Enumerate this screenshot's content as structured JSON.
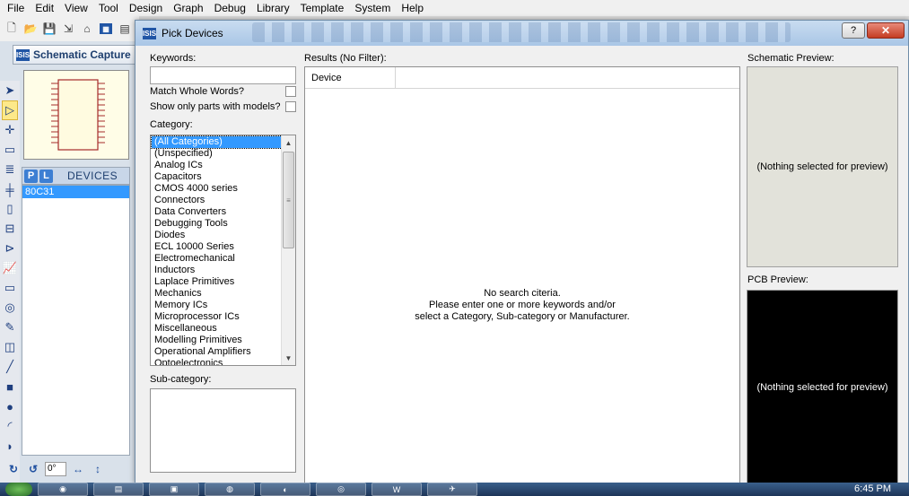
{
  "app": {
    "menu": [
      "File",
      "Edit",
      "View",
      "Tool",
      "Design",
      "Graph",
      "Debug",
      "Library",
      "Template",
      "System",
      "Help"
    ],
    "tab_label": "Schematic Capture",
    "logo_text": "ISIS",
    "devices_title": "DEVICES",
    "pick_btn": "P",
    "lib_btn": "L",
    "devices": [
      "80C31"
    ],
    "rotation_value": "0°"
  },
  "dialog": {
    "title": "Pick Devices",
    "help_label": "?",
    "close_label": "✕",
    "keywords_label": "Keywords:",
    "keywords_value": "",
    "match_whole_label": "Match Whole Words?",
    "models_only_label": "Show only parts with models?",
    "category_label": "Category:",
    "categories": [
      "(All Categories)",
      "(Unspecified)",
      "Analog ICs",
      "Capacitors",
      "CMOS 4000 series",
      "Connectors",
      "Data Converters",
      "Debugging Tools",
      "Diodes",
      "ECL 10000 Series",
      "Electromechanical",
      "Inductors",
      "Laplace Primitives",
      "Mechanics",
      "Memory ICs",
      "Microprocessor ICs",
      "Miscellaneous",
      "Modelling Primitives",
      "Operational Amplifiers",
      "Optoelectronics"
    ],
    "selected_category": "(All Categories)",
    "subcategory_label": "Sub-category:",
    "results_label": "Results (No Filter):",
    "results_column": "Device",
    "results_message_1": "No search citeria.",
    "results_message_2": "Please enter one or more keywords and/or",
    "results_message_3": "select a Category, Sub-category or Manufacturer.",
    "schematic_preview_label": "Schematic Preview:",
    "schematic_preview_text": "(Nothing selected for preview)",
    "pcb_preview_label": "PCB Preview:",
    "pcb_preview_text": "(Nothing selected for preview)"
  },
  "taskbar": {
    "clock": "6:45 PM"
  },
  "colors": {
    "selection": "#3399ff",
    "pcb_bg": "#000000",
    "schematic_bg": "#e2e2da"
  }
}
